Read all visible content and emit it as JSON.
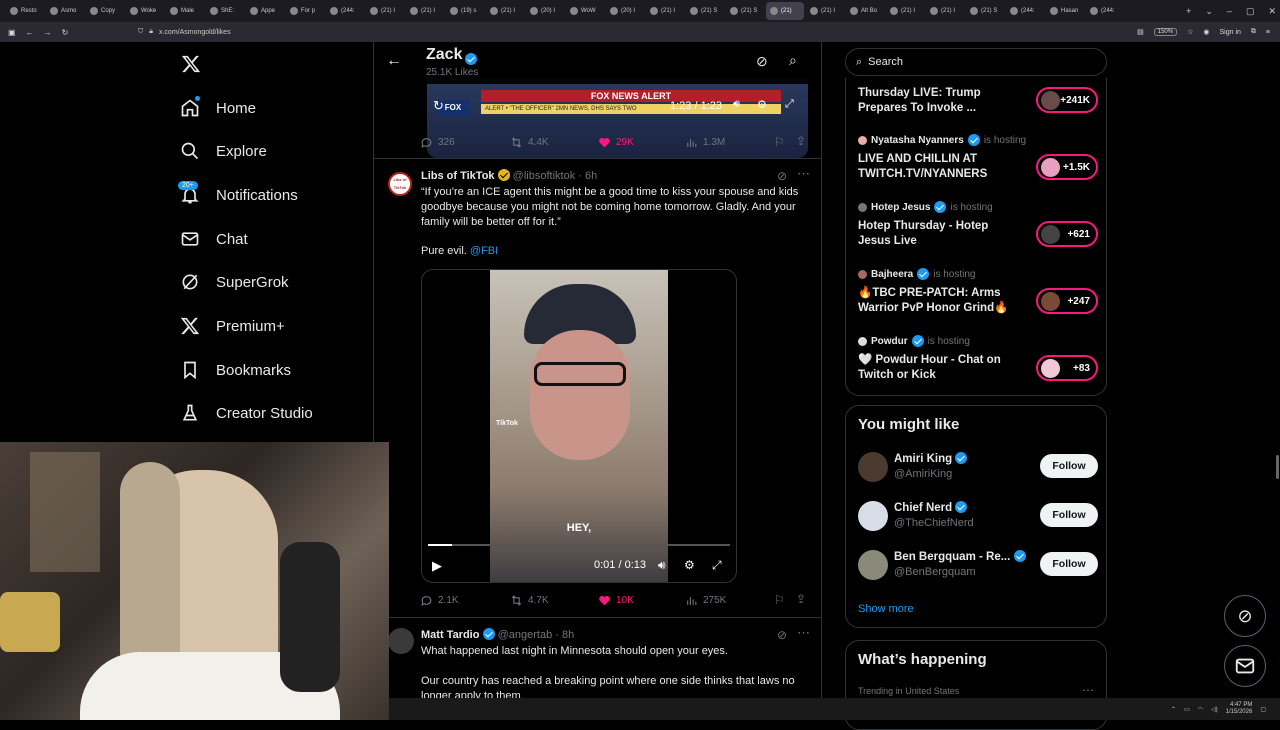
{
  "browser": {
    "tabs": [
      "Resto",
      "Asmo",
      "Copy",
      "Woke",
      "Male",
      "ShE:",
      "Appe",
      "For p",
      "(244:",
      "(21) I",
      "(21) I",
      "(19) s",
      "(21) I",
      "(20) I",
      "WoW",
      "(20) I",
      "(21) I",
      "(21) S",
      "(21) S",
      "(21)",
      "(21) I",
      "Alt Bo",
      "(21) I",
      "(21) I",
      "(21) S",
      "(244:",
      "Hasan",
      "(244:"
    ],
    "active_tab_index": 19,
    "url": "x.com/Asmongold/likes",
    "zoom": "150%",
    "signin": "Sign in"
  },
  "sidebar": {
    "items": [
      {
        "label": "Home"
      },
      {
        "label": "Explore"
      },
      {
        "label": "Notifications"
      },
      {
        "label": "Chat"
      },
      {
        "label": "SuperGrok"
      },
      {
        "label": "Premium+"
      },
      {
        "label": "Bookmarks"
      },
      {
        "label": "Creator Studio"
      }
    ],
    "notifications_badge": "20+"
  },
  "header": {
    "name": "Zack",
    "likes": "25.1K Likes"
  },
  "top_video": {
    "time": "1:23 / 1:23",
    "banner": "FOX NEWS ALERT",
    "ticker": "ALERT • \"THE OFFICER\" 2MN NEWS, DHS SAYS TWO"
  },
  "tweet0_actions": {
    "replies": "326",
    "retweets": "4.4K",
    "likes": "29K",
    "views": "1.3M"
  },
  "tweet1": {
    "author": "Libs of TikTok",
    "handle": "@libsoftiktok",
    "time": "· 6h",
    "avatar_text": "Libs of TikTok",
    "text": "“If you’re an ICE agent this might be a good time to kiss your spouse and kids goodbye because you might not be coming home tomorrow. Gladly. And your family will be better off for it.”",
    "text2": "Pure evil.",
    "mention": "@FBI",
    "video_caption": "HEY,",
    "video_time": "0:01 / 0:13",
    "watermark": "TikTok",
    "replies": "2.1K",
    "retweets": "4.7K",
    "likes": "10K",
    "views": "275K",
    "progress": 0.08
  },
  "tweet2": {
    "author": "Matt Tardio",
    "handle": "@angertab",
    "time": "· 8h",
    "text": "What happened last night in Minnesota should open your eyes.",
    "text2": "Our country has reached a breaking point where one side thinks that laws no longer apply to them."
  },
  "search": {
    "placeholder": "Search"
  },
  "live": [
    {
      "host": "",
      "hosting": "",
      "title": "Thursday LIVE: Trump Prepares To Invoke ...",
      "count": "+241K"
    },
    {
      "host": "Nyatasha Nyanners",
      "hosting": "is hosting",
      "title": "LIVE AND CHILLIN AT TWITCH.TV/NYANNERS",
      "count": "+1.5K"
    },
    {
      "host": "Hotep Jesus",
      "hosting": "is hosting",
      "title": "Hotep Thursday - Hotep Jesus Live",
      "count": "+621"
    },
    {
      "host": "Bajheera",
      "hosting": "is hosting",
      "title": "🔥TBC PRE-PATCH: Arms Warrior PvP Honor Grind🔥",
      "count": "+247"
    },
    {
      "host": "Powdur",
      "hosting": "is hosting",
      "title": "🤍 Powdur Hour - Chat on Twitch or Kick",
      "count": "+83"
    }
  ],
  "you_might_like": {
    "title": "You might like",
    "people": [
      {
        "name": "Amiri King",
        "handle": "@AmiriKing",
        "button": "Follow"
      },
      {
        "name": "Chief Nerd",
        "handle": "@TheChiefNerd",
        "button": "Follow"
      },
      {
        "name": "Ben Bergquam - Re...",
        "handle": "@BenBergquam",
        "button": "Follow"
      }
    ],
    "show_more": "Show more"
  },
  "whats_happening": {
    "title": "What’s happening",
    "sub": "Trending in United States"
  },
  "taskbar": {
    "time": "4:47 PM",
    "date": "1/15/2026"
  },
  "colors": {
    "accent": "#1d9bf0",
    "like": "#f91880",
    "gold": "#e2b719"
  }
}
